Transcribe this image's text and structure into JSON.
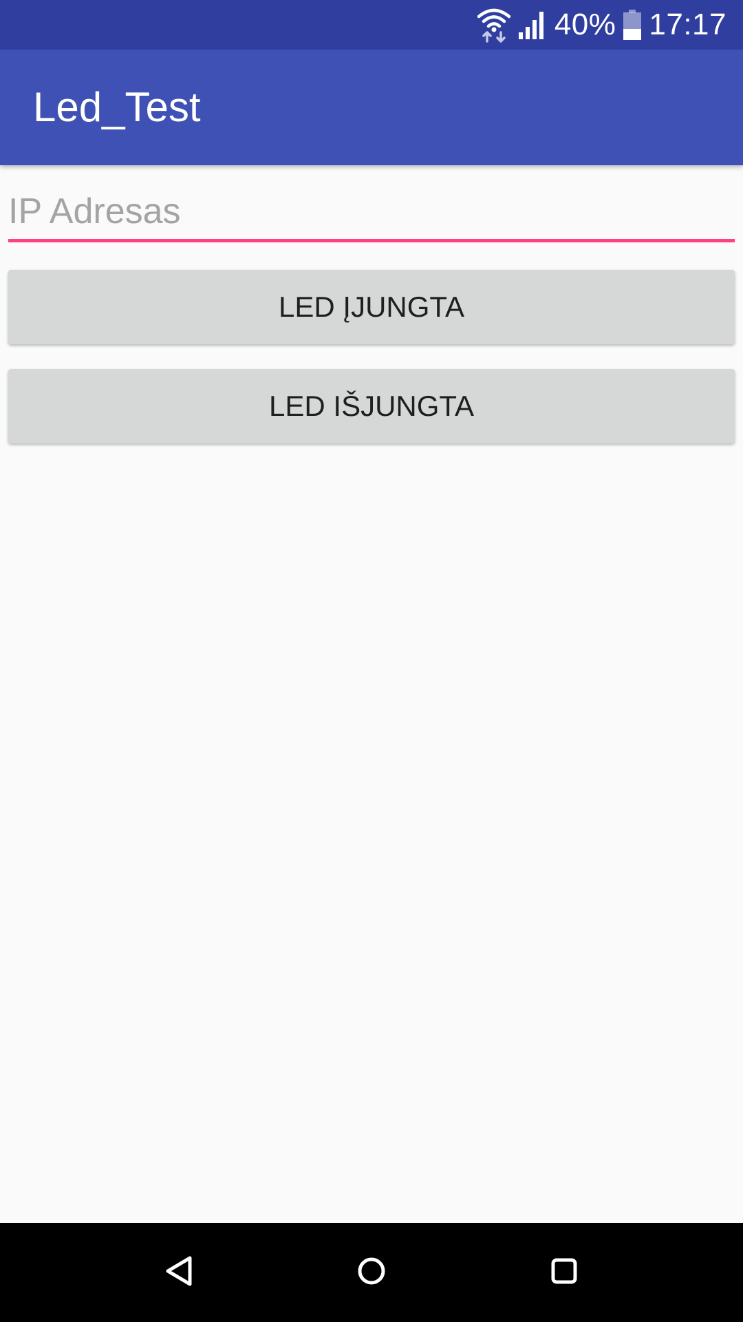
{
  "status_bar": {
    "battery_percent_text": "40%",
    "time": "17:17",
    "background_color": "#303f9f",
    "icons": [
      "wifi-icon",
      "signal-icon",
      "battery-icon"
    ],
    "battery_level": 0.4
  },
  "app_bar": {
    "title": "Led_Test",
    "background_color": "#3f51b5"
  },
  "ip_input": {
    "placeholder": "IP Adresas",
    "value": "",
    "underline_color": "#ff4081"
  },
  "buttons": {
    "led_on_label": "LED ĮJUNGTA",
    "led_off_label": "LED IŠJUNGTA",
    "background_color": "#d6d7d7"
  },
  "nav_bar": {
    "icons": [
      "back-icon",
      "home-icon",
      "recents-icon"
    ],
    "background_color": "#000000"
  }
}
